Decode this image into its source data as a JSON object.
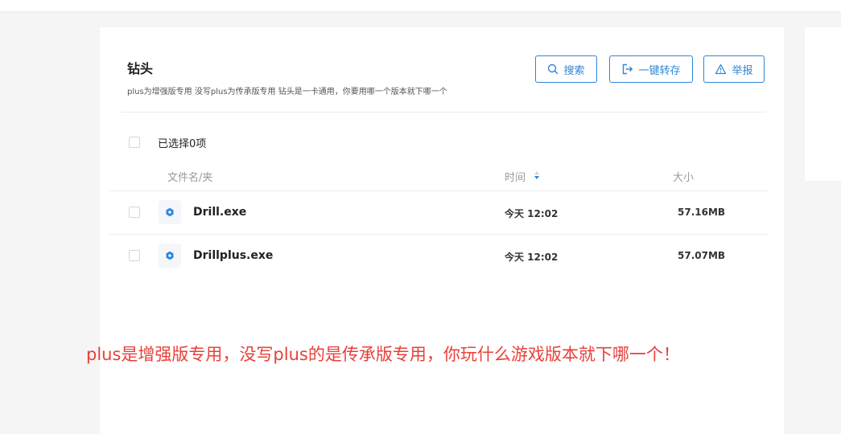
{
  "share": {
    "title": "钻头",
    "description": "plus为增强版专用 没写plus为传承版专用 钻头是一卡通用，你要用哪一个版本就下哪一个"
  },
  "actions": {
    "search_label": "搜索",
    "save_label": "一键转存",
    "report_label": "举报"
  },
  "selection": {
    "label": "已选择0项"
  },
  "columns": {
    "name": "文件名/夹",
    "time": "时间",
    "size": "大小"
  },
  "files": [
    {
      "name": "Drill.exe",
      "time": "今天 12:02",
      "size": "57.16MB",
      "icon": "exe-gear-icon"
    },
    {
      "name": "Drillplus.exe",
      "time": "今天 12:02",
      "size": "57.07MB",
      "icon": "exe-gear-icon"
    }
  ],
  "annotation": "plus是增强版专用，没写plus的是传承版专用，你玩什么游戏版本就下哪一个！",
  "colors": {
    "accent": "#2d86d9",
    "annotation": "#e8403a",
    "background": "#f5f5f6"
  }
}
